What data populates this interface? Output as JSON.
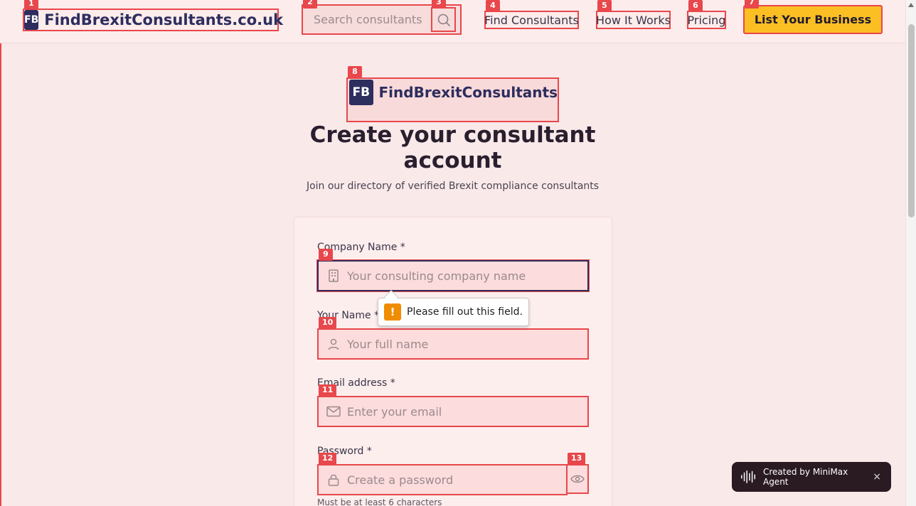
{
  "header": {
    "brand_badge": "FB",
    "brand_name": "FindBrexitConsultants.co.uk",
    "search_placeholder": "Search consultants",
    "nav": [
      "Find Consultants",
      "How It Works",
      "Pricing"
    ],
    "cta": "List Your Business"
  },
  "hero": {
    "brand_badge": "FB",
    "brand_name": "FindBrexitConsultants",
    "title": "Create your consultant account",
    "subtitle": "Join our directory of verified Brexit compliance consultants"
  },
  "form": {
    "company_label": "Company Name *",
    "company_placeholder": "Your consulting company name",
    "name_label": "Your Name *",
    "name_placeholder": "Your full name",
    "email_label": "Email address *",
    "email_placeholder": "Enter your email",
    "password_label": "Password *",
    "password_placeholder": "Create a password",
    "password_hint": "Must be at least 6 characters"
  },
  "tooltip": {
    "icon": "!",
    "text": "Please fill out this field."
  },
  "markers": [
    "1",
    "2",
    "3",
    "4",
    "5",
    "6",
    "7",
    "8",
    "9",
    "10",
    "11",
    "12",
    "13"
  ],
  "badge": {
    "text": "Created by MiniMax Agent",
    "close": "×"
  },
  "colors": {
    "accent": "#e8474b",
    "brand": "#2d2d5e",
    "cta": "#fbbf24"
  }
}
